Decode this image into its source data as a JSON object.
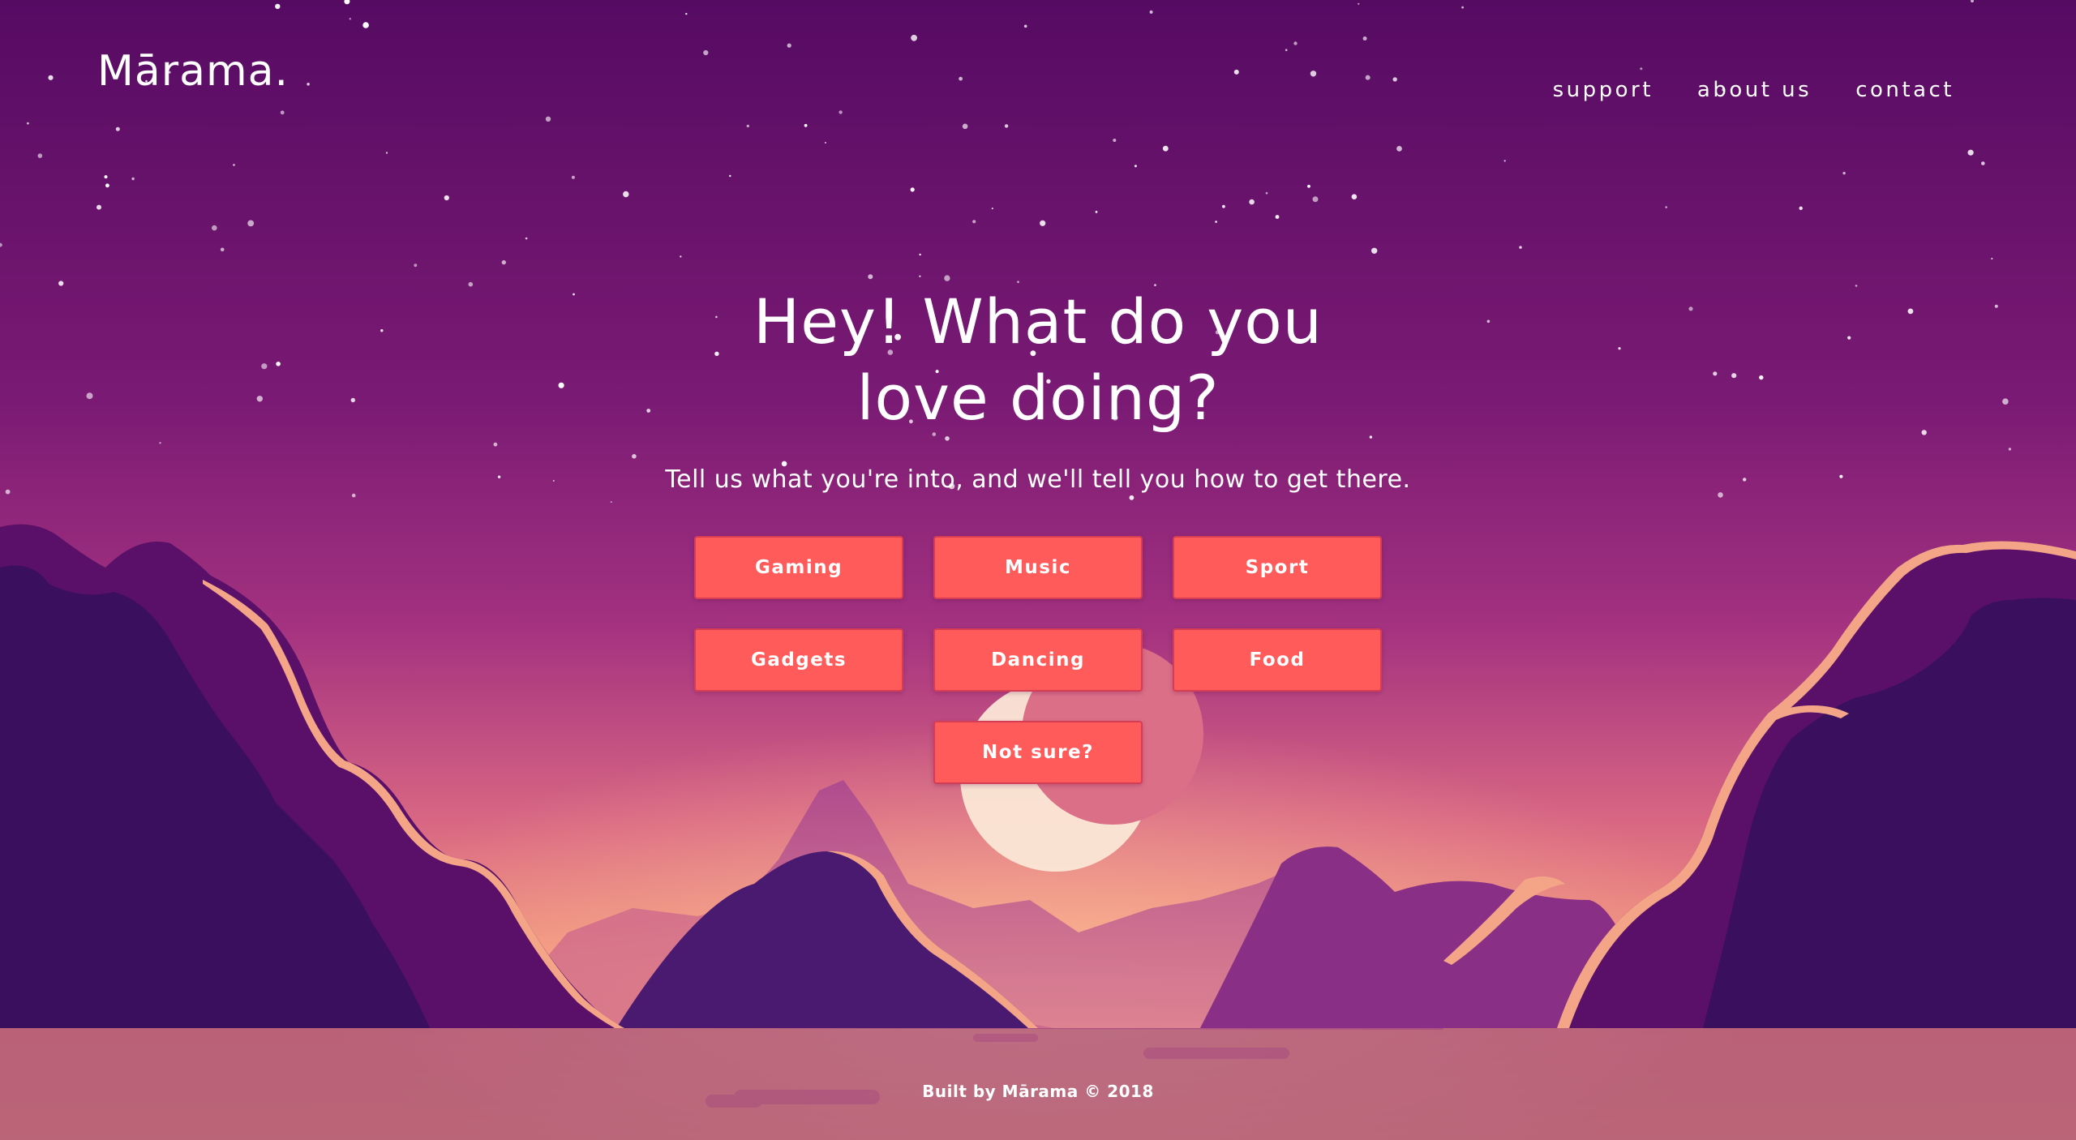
{
  "brand": {
    "logo_text": "Mārama."
  },
  "nav": {
    "support": "support",
    "about": "about us",
    "contact": "contact"
  },
  "hero": {
    "heading": "Hey! What do you love doing?",
    "subheading": "Tell us what you're into, and we'll tell you how to get there."
  },
  "interests": [
    "Gaming",
    "Music",
    "Sport",
    "Gadgets",
    "Dancing",
    "Food"
  ],
  "not_sure_label": "Not sure?",
  "footer": {
    "credit": "Built by Mārama © 2018"
  },
  "colors": {
    "sky_top": "#570b63",
    "sky_mid": "#8a2378",
    "horizon": "#f59a7e",
    "button": "#ff5b5b",
    "mountain_dark": "#3a0f5e",
    "moon": "#fbe7d6"
  }
}
